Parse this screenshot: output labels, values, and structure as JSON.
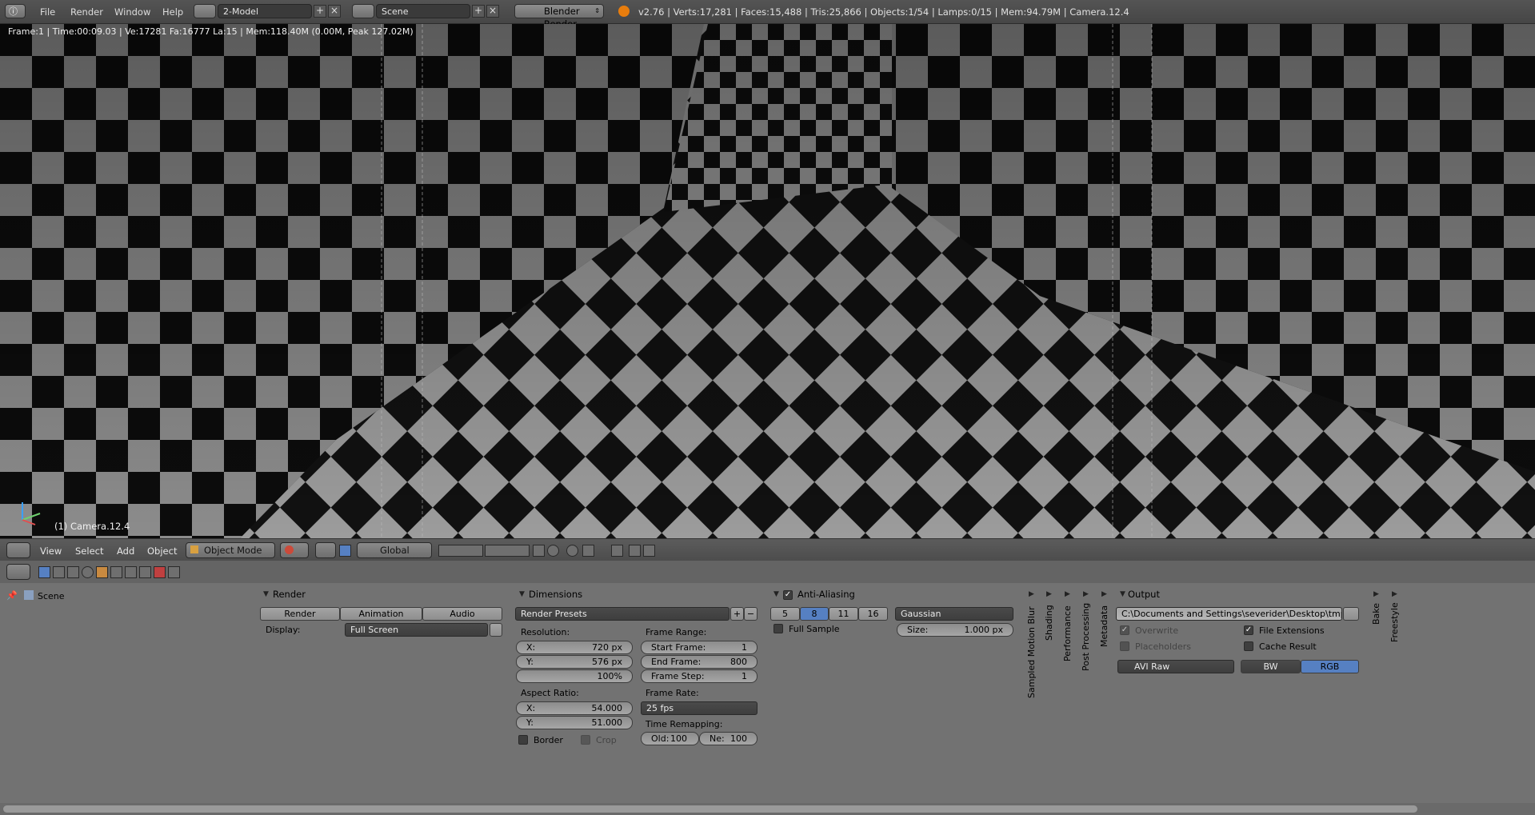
{
  "topbar": {
    "menus": [
      "File",
      "Render",
      "Window",
      "Help"
    ],
    "screen_layout": "2-Model",
    "scene": "Scene",
    "render_engine": "Blender Render",
    "stats": "v2.76 | Verts:17,281 | Faces:15,488 | Tris:25,866 | Objects:1/54 | Lamps:0/15 | Mem:94.79M | Camera.12.4"
  },
  "viewport": {
    "render_info": "Frame:1 | Time:00:09.03 | Ve:17281 Fa:16777 La:15 | Mem:118.40M (0.00M, Peak 127.02M)",
    "camera_label": "(1) Camera.12.4"
  },
  "viewport_header": {
    "menus": [
      "View",
      "Select",
      "Add",
      "Object"
    ],
    "mode": "Object Mode",
    "orientation": "Global"
  },
  "properties": {
    "context": "Scene",
    "render_panel": {
      "title": "Render",
      "buttons": [
        "Render",
        "Animation",
        "Audio"
      ],
      "display_label": "Display:",
      "display_value": "Full Screen"
    },
    "dimensions_panel": {
      "title": "Dimensions",
      "presets": "Render Presets",
      "resolution_label": "Resolution:",
      "res_x_label": "X:",
      "res_x": "720 px",
      "res_y_label": "Y:",
      "res_y": "576 px",
      "res_pct": "100%",
      "aspect_label": "Aspect Ratio:",
      "asp_x_label": "X:",
      "asp_x": "54.000",
      "asp_y_label": "Y:",
      "asp_y": "51.000",
      "border_label": "Border",
      "crop_label": "Crop",
      "frame_range_label": "Frame Range:",
      "start_label": "Start Frame:",
      "start": "1",
      "end_label": "End Frame:",
      "end": "800",
      "step_label": "Frame Step:",
      "step": "1",
      "frame_rate_label": "Frame Rate:",
      "frame_rate": "25 fps",
      "time_remap_label": "Time Remapping:",
      "old_label": "Old:",
      "old": "100",
      "new_label": "Ne:",
      "new": "100"
    },
    "aa_panel": {
      "title": "Anti-Aliasing",
      "samples": [
        "5",
        "8",
        "11",
        "16"
      ],
      "selected_sample": "8",
      "filter": "Gaussian",
      "full_sample_label": "Full Sample",
      "size_label": "Size:",
      "size": "1.000 px"
    },
    "collapsed_panels": [
      "Sampled Motion Blur",
      "Shading",
      "Performance",
      "Post Processing",
      "Metadata"
    ],
    "output_panel": {
      "title": "Output",
      "path": "C:\\Documents and Settings\\severider\\Desktop\\tmp\\se...",
      "overwrite_label": "Overwrite",
      "file_extensions_label": "File Extensions",
      "placeholders_label": "Placeholders",
      "cache_result_label": "Cache Result",
      "format": "AVI Raw",
      "color_modes": [
        "BW",
        "RGB"
      ],
      "selected_color_mode": "RGB"
    },
    "right_panels": [
      "Bake",
      "Freestyle"
    ]
  },
  "colors": {
    "accent_blue": "#5680c2",
    "header_bg": "#4b4b4b",
    "panel_bg": "#727272"
  }
}
